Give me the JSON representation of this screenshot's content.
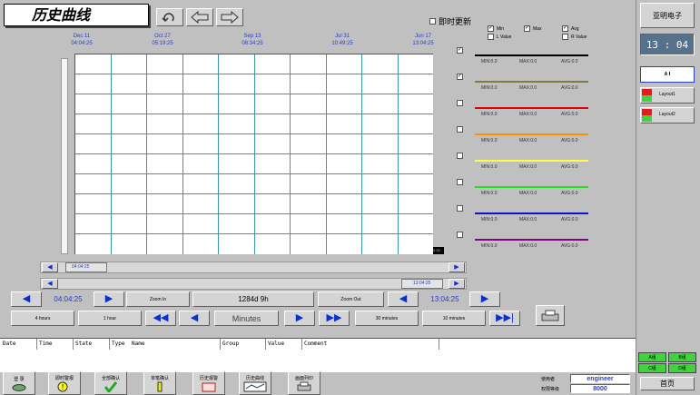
{
  "title": "历史曲线",
  "realtime_label": "即时更新",
  "header_dates": [
    {
      "date": "Dec 11",
      "time": "04:04:25"
    },
    {
      "date": "Oct 27",
      "time": "05:19:25"
    },
    {
      "date": "Sep 13",
      "time": "08:34:25"
    },
    {
      "date": "Jul 31",
      "time": "10:49:25"
    },
    {
      "date": "Jun 17",
      "time": "13:04:25"
    }
  ],
  "legend_options": {
    "min": "Min",
    "max": "Max",
    "avg": "Avg",
    "lvalue": "L Value",
    "rvalue": "R Value"
  },
  "legend_rows": [
    {
      "color": "#000000",
      "min": "MIN:0.0",
      "max": "MAX:0.0",
      "avg": "AVG:0.0",
      "checked": "✓"
    },
    {
      "color": "#7f7f3a",
      "min": "MIN:0.0",
      "max": "MAX:0.0",
      "avg": "AVG:0.0",
      "checked": "✓"
    },
    {
      "color": "#e00000",
      "min": "MIN:0.0",
      "max": "MAX:0.0",
      "avg": "AVG:0.0",
      "checked": ""
    },
    {
      "color": "#ff9000",
      "min": "MIN:0.0",
      "max": "MAX:0.0",
      "avg": "AVG:0.0",
      "checked": ""
    },
    {
      "color": "#ffff40",
      "min": "MIN:0.0",
      "max": "MAX:0.0",
      "avg": "AVG:0.0",
      "checked": ""
    },
    {
      "color": "#20e020",
      "min": "MIN:0.0",
      "max": "MAX:0.0",
      "avg": "AVG:0.0",
      "checked": ""
    },
    {
      "color": "#1010d0",
      "min": "MIN:0.0",
      "max": "MAX:0.0",
      "avg": "AVG:0.0",
      "checked": ""
    },
    {
      "color": "#800080",
      "min": "MIN:0.0",
      "max": "MAX:0.0",
      "avg": "AVG:0.0",
      "checked": ""
    }
  ],
  "plot_corner": "0.00",
  "scroll": {
    "start": "04:04:25",
    "end": "13:04:25"
  },
  "controls": {
    "start_time": "04:04:25",
    "zoom_in": "Zoom In",
    "span": "1284d 9h",
    "zoom_out": "Zoom Out",
    "end_time": "13:04:25",
    "four_hours": "4 hours",
    "one_hour": "1 hour",
    "unit": "Minutes",
    "thirty_min": "30 minutes",
    "ten_min": "10 minutes"
  },
  "right_panel": {
    "company": "亚明电子",
    "clock": "13 : 04",
    "a_group": "A Ⅰ",
    "layout1": "Layout1",
    "layout2": "Layout2",
    "group_a": "A组",
    "group_b": "B组",
    "group_c": "C组",
    "group_d": "D组",
    "home": "首页"
  },
  "event_columns": [
    "Date",
    "Time",
    "State",
    "Type",
    "Name",
    "Group",
    "Value",
    "Comment"
  ],
  "toolbar": [
    {
      "label": "登 录",
      "icon": "login-icon"
    },
    {
      "label": "即时警报",
      "icon": "alarm-icon"
    },
    {
      "label": "全部确认",
      "icon": "confirm-all-icon"
    },
    {
      "label": "单笔确认",
      "icon": "confirm-one-icon"
    },
    {
      "label": "历史报警",
      "icon": "history-alarm-icon"
    },
    {
      "label": "历史曲线",
      "icon": "history-trend-icon"
    },
    {
      "label": "画面列印",
      "icon": "print-icon"
    }
  ],
  "status": {
    "user_label": "使用者",
    "user": "engineer",
    "password_label": "权限等级",
    "level": "8000"
  }
}
